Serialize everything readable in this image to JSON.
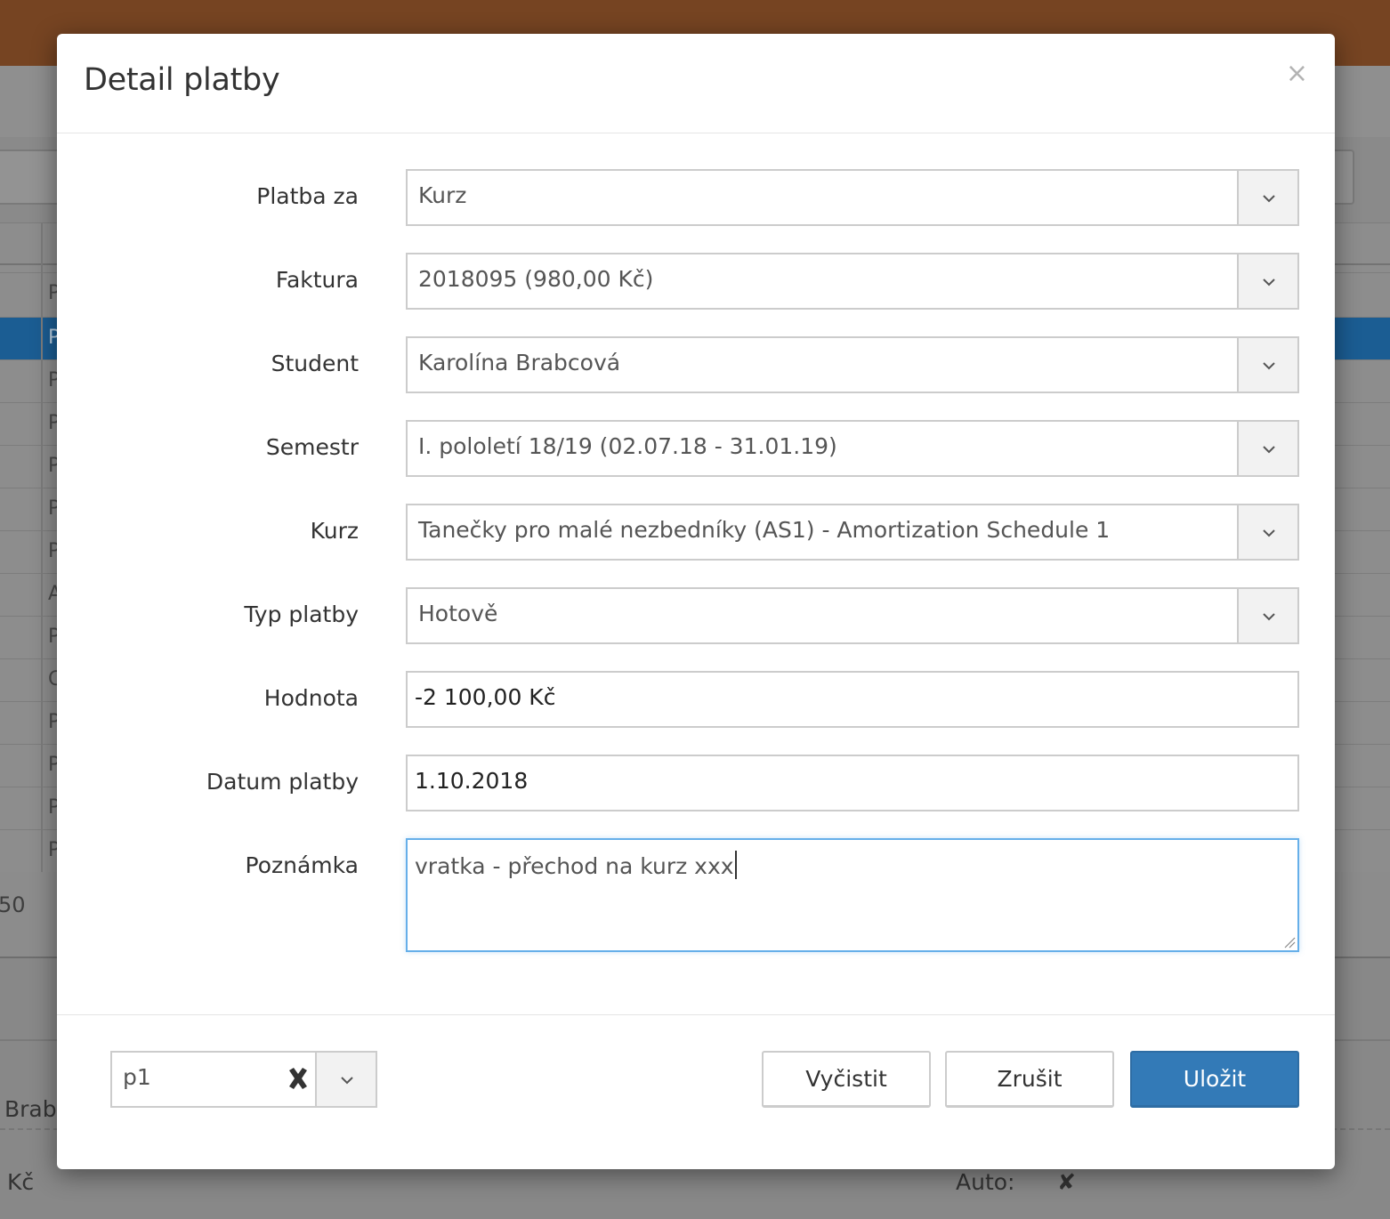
{
  "background": {
    "row_letters": [
      "P",
      "P",
      "P",
      "P",
      "P",
      "P",
      "P",
      "A",
      "P",
      "C",
      "P",
      "P",
      "P",
      "P"
    ],
    "footer_count": "50",
    "name_fragment": "Brab",
    "currency_fragment": "Kč",
    "auto_label": "Auto:",
    "auto_value": "✘"
  },
  "modal": {
    "title": "Detail platby",
    "close_glyph": "×",
    "fields": {
      "platba_za": {
        "label": "Platba za",
        "value": "Kurz"
      },
      "faktura": {
        "label": "Faktura",
        "value": "2018095 (980,00 Kč)"
      },
      "student": {
        "label": "Student",
        "value": "Karolína Brabcová"
      },
      "semestr": {
        "label": "Semestr",
        "value": "I. pololetí 18/19 (02.07.18 - 31.01.19)"
      },
      "kurz": {
        "label": "Kurz",
        "value": "Tanečky pro malé nezbedníky (AS1) - Amortization Schedule 1"
      },
      "typ_platby": {
        "label": "Typ platby",
        "value": "Hotově"
      },
      "hodnota": {
        "label": "Hodnota",
        "value": "-2 100,00 Kč"
      },
      "datum_platby": {
        "label": "Datum platby",
        "value": "1.10.2018"
      },
      "poznamka": {
        "label": "Poznámka",
        "value": "vratka - přechod na kurz xxx"
      }
    },
    "footer": {
      "template_select_value": "p1",
      "clear_label": "Vyčistit",
      "cancel_label": "Zrušit",
      "save_label": "Uložit"
    }
  },
  "colors": {
    "topbar": "#764422",
    "primary": "#337ab7",
    "focus_border": "#66afe9"
  }
}
